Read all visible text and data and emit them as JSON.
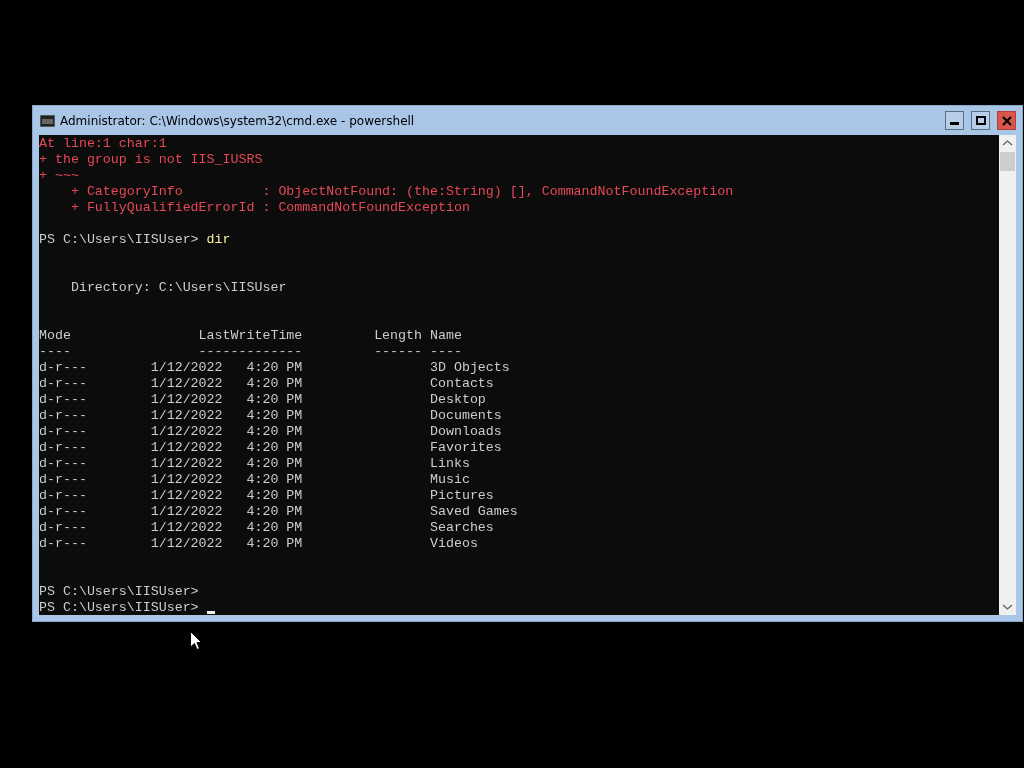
{
  "window": {
    "title": "Administrator: C:\\Windows\\system32\\cmd.exe - powershell"
  },
  "console": {
    "lines": [
      {
        "kind": "error",
        "text": "At line:1 char:1"
      },
      {
        "kind": "error",
        "text": "+ the group is not IIS_IUSRS"
      },
      {
        "kind": "error",
        "text": "+ ~~~"
      },
      {
        "kind": "error",
        "text": "    + CategoryInfo          : ObjectNotFound: (the:String) [], CommandNotFoundException"
      },
      {
        "kind": "error",
        "text": "    + FullyQualifiedErrorId : CommandNotFoundException"
      },
      {
        "kind": "blank"
      },
      {
        "kind": "prompt",
        "text": "PS C:\\Users\\IISUser> ",
        "command": "dir"
      },
      {
        "kind": "blank"
      },
      {
        "kind": "blank"
      },
      {
        "kind": "output",
        "text": "    Directory: C:\\Users\\IISUser"
      },
      {
        "kind": "blank"
      },
      {
        "kind": "blank"
      },
      {
        "kind": "output",
        "text": "Mode                LastWriteTime         Length Name"
      },
      {
        "kind": "output",
        "text": "----                -------------         ------ ----"
      },
      {
        "kind": "output",
        "text": "d-r---        1/12/2022   4:20 PM                3D Objects"
      },
      {
        "kind": "output",
        "text": "d-r---        1/12/2022   4:20 PM                Contacts"
      },
      {
        "kind": "output",
        "text": "d-r---        1/12/2022   4:20 PM                Desktop"
      },
      {
        "kind": "output",
        "text": "d-r---        1/12/2022   4:20 PM                Documents"
      },
      {
        "kind": "output",
        "text": "d-r---        1/12/2022   4:20 PM                Downloads"
      },
      {
        "kind": "output",
        "text": "d-r---        1/12/2022   4:20 PM                Favorites"
      },
      {
        "kind": "output",
        "text": "d-r---        1/12/2022   4:20 PM                Links"
      },
      {
        "kind": "output",
        "text": "d-r---        1/12/2022   4:20 PM                Music"
      },
      {
        "kind": "output",
        "text": "d-r---        1/12/2022   4:20 PM                Pictures"
      },
      {
        "kind": "output",
        "text": "d-r---        1/12/2022   4:20 PM                Saved Games"
      },
      {
        "kind": "output",
        "text": "d-r---        1/12/2022   4:20 PM                Searches"
      },
      {
        "kind": "output",
        "text": "d-r---        1/12/2022   4:20 PM                Videos"
      },
      {
        "kind": "blank"
      },
      {
        "kind": "blank"
      },
      {
        "kind": "prompt",
        "text": "PS C:\\Users\\IISUser>"
      },
      {
        "kind": "input",
        "text": "PS C:\\Users\\IISUser> "
      }
    ]
  }
}
